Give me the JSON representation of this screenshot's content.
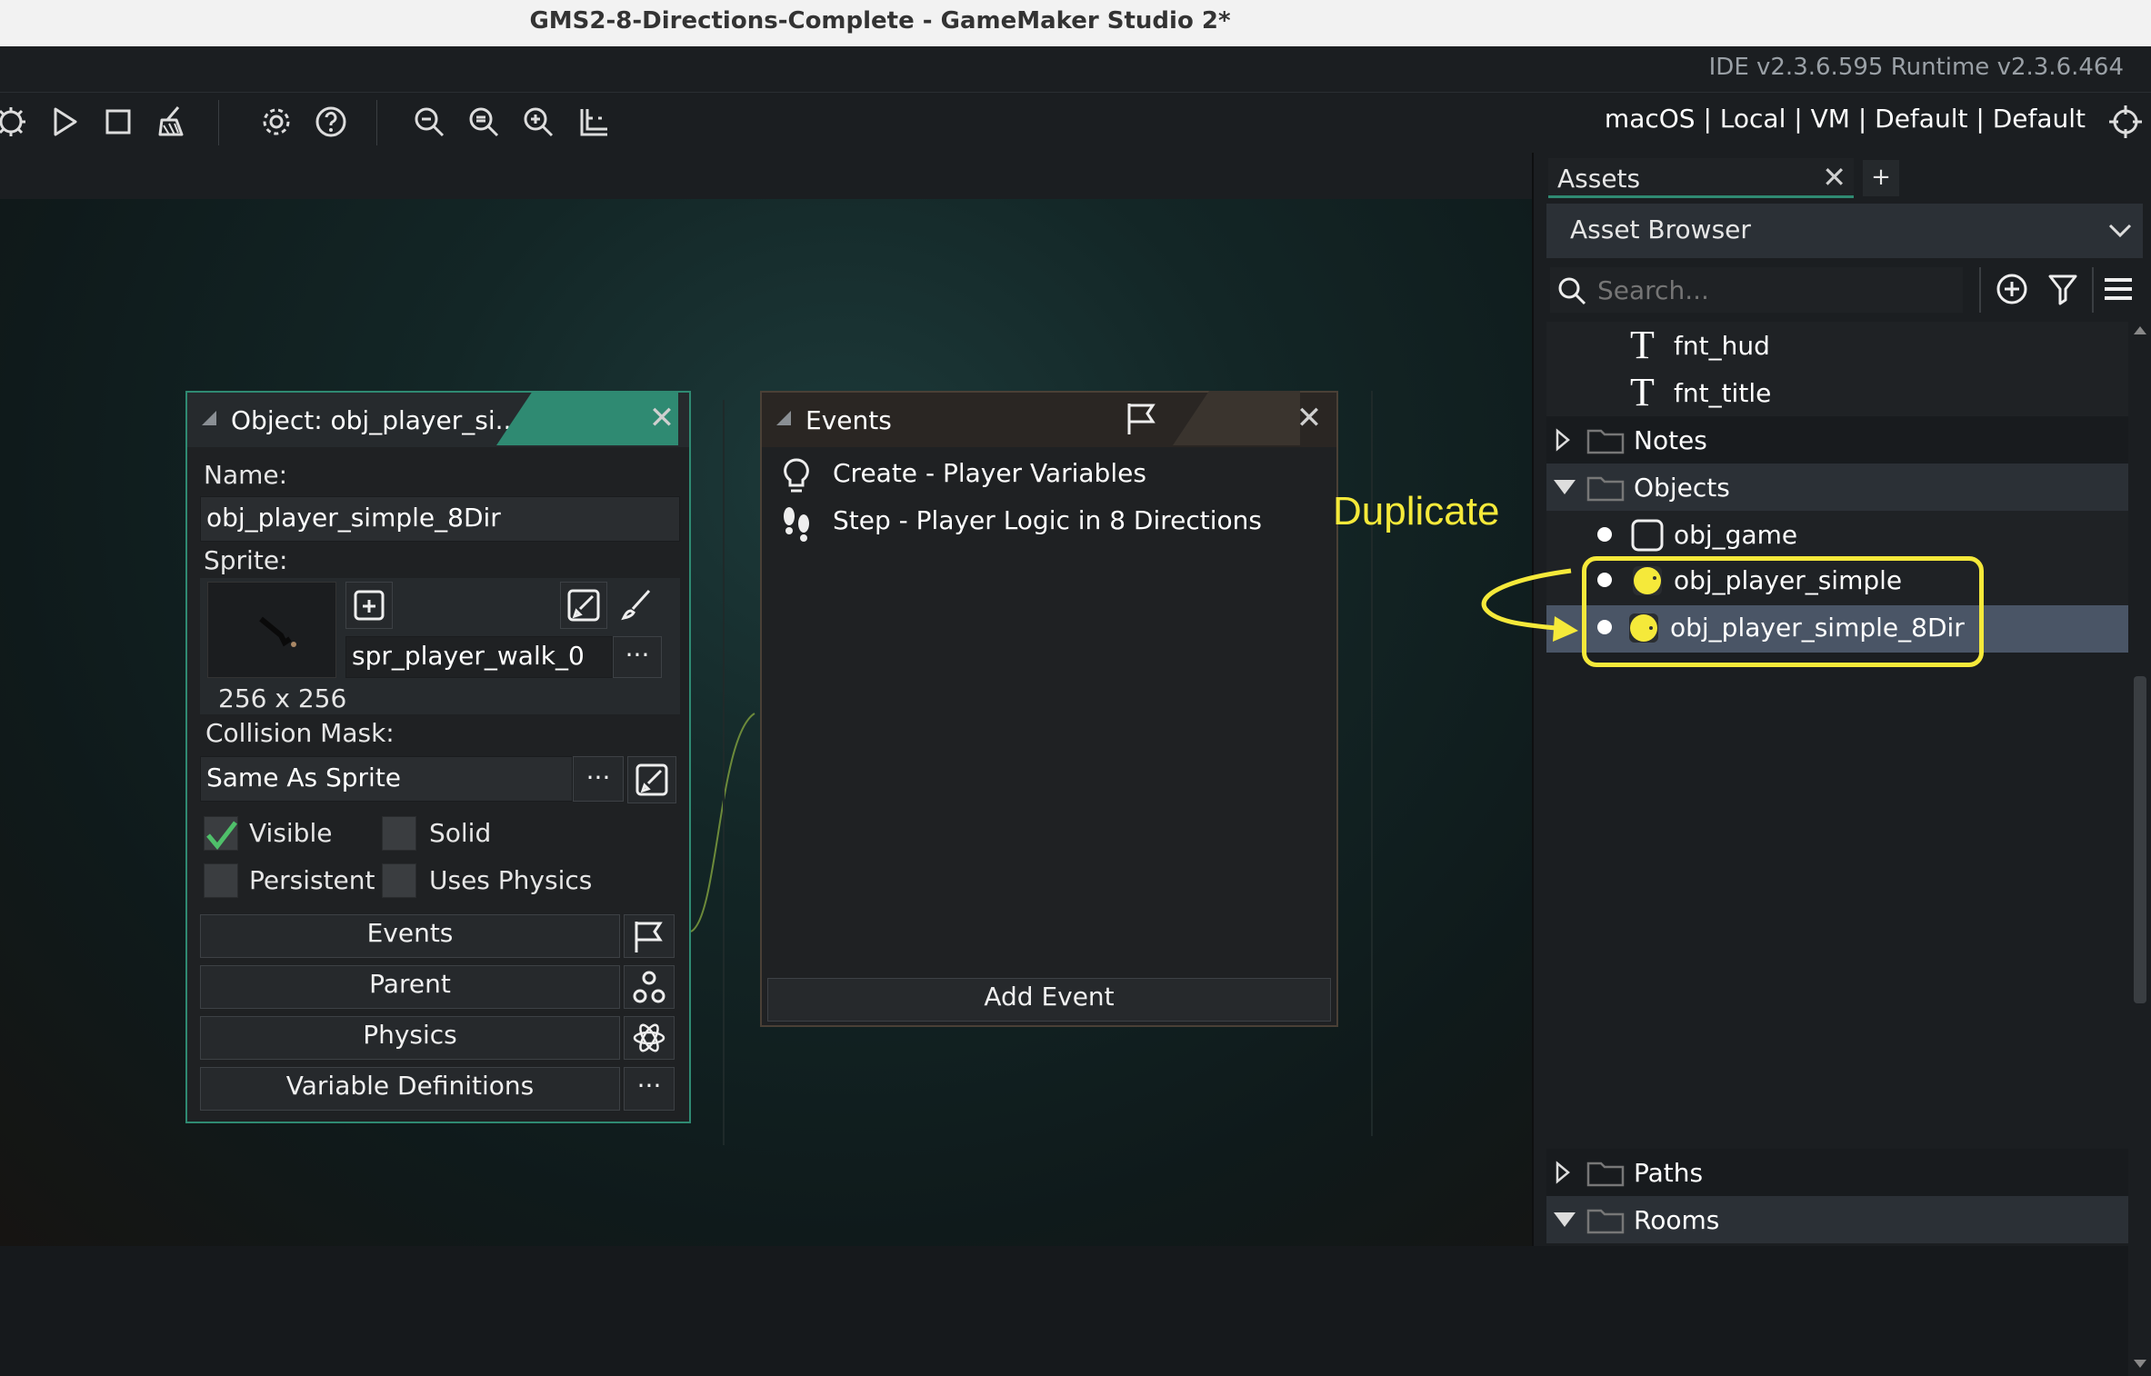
{
  "window": {
    "title": "GMS2-8-Directions-Complete - GameMaker Studio 2*"
  },
  "version": {
    "text": "IDE v2.3.6.595  Runtime v2.3.6.464"
  },
  "toolbar": {
    "buttons": [
      "debug-icon",
      "play-icon",
      "stop-icon",
      "clean-icon",
      "settings-icon",
      "help-icon",
      "zoom-out-icon",
      "zoom-reset-icon",
      "zoom-in-icon",
      "fit-icon"
    ],
    "targets": "macOS | Local | VM | Default | Default"
  },
  "object_panel": {
    "title": "Object: obj_player_si...",
    "name_label": "Name:",
    "name_value": "obj_player_simple_8Dir",
    "sprite_label": "Sprite:",
    "sprite_name": "spr_player_walk_0",
    "sprite_size": "256 x 256",
    "collision_label": "Collision Mask:",
    "collision_value": "Same As Sprite",
    "more": "···",
    "visible": "Visible",
    "solid": "Solid",
    "persistent": "Persistent",
    "uses_physics": "Uses Physics",
    "checks": {
      "visible": true,
      "solid": false,
      "persistent": false,
      "uses_physics": false
    },
    "events_btn": "Events",
    "parent_btn": "Parent",
    "physics_btn": "Physics",
    "vardefs_btn": "Variable Definitions"
  },
  "events_panel": {
    "title": "Events",
    "items": [
      {
        "label": "Create - Player Variables",
        "icon": "lightbulb-icon"
      },
      {
        "label": "Step - Player Logic in 8 Directions",
        "icon": "footsteps-icon"
      }
    ],
    "add_event": "Add Event"
  },
  "annotation": {
    "text": "Duplicate",
    "color": "#f5e93a"
  },
  "assets": {
    "tab_label": "Assets",
    "tab_add": "+",
    "browser_title": "Asset Browser",
    "search_placeholder": "Search...",
    "tree": {
      "fnt_hud": "fnt_hud",
      "fnt_title": "fnt_title",
      "notes": "Notes",
      "objects": "Objects",
      "obj_game": "obj_game",
      "obj_player_simple": "obj_player_simple",
      "obj_player_simple_8dir": "obj_player_simple_8Dir",
      "paths": "Paths",
      "rooms": "Rooms"
    }
  },
  "colors": {
    "accent": "#2f8a72",
    "highlight": "#f5e93a",
    "selected_row": "#4a5566"
  }
}
